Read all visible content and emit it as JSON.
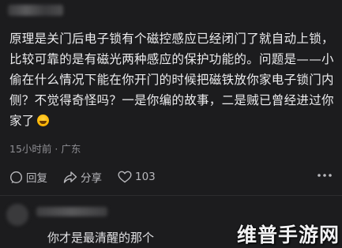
{
  "comment": {
    "text": "原理是关门后电子锁有个磁控感应已经闭门了就自动上锁，比较可靠的是有磁光两种感应的保护功能的。问题是——小偷在什么情况下能在你开门的时候把磁铁放你家电子锁门内侧？不觉得奇怪吗？一是你编的故事，二是贼已曾经进过你家了",
    "emoji": "laughing-face",
    "time": "15小时前",
    "separator": "·",
    "location": "广东"
  },
  "actions": {
    "reply_label": "回复",
    "share_label": "分享",
    "like_count": "103"
  },
  "reply_preview": {
    "text": "你才是最清醒的那个"
  },
  "watermark": "维普手游网",
  "colors": {
    "background": "#1c1c1e",
    "text": "#ececee",
    "meta": "#8e8e93"
  }
}
